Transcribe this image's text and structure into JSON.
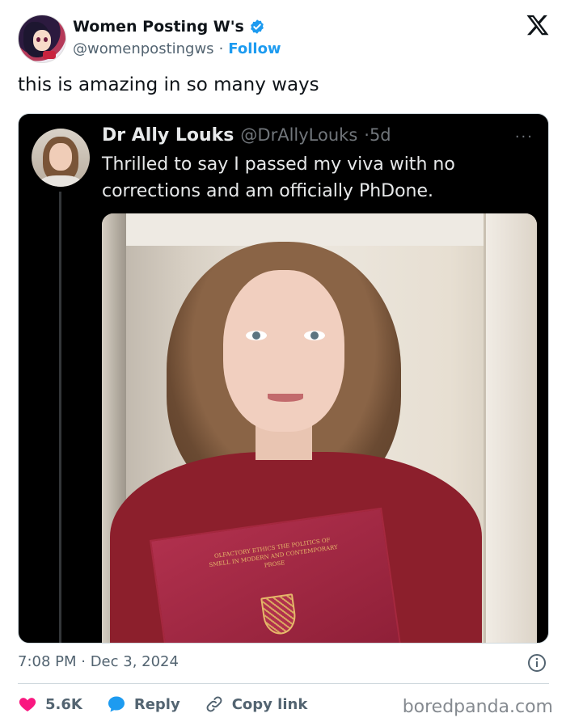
{
  "author": {
    "display_name": "Women Posting W's",
    "handle": "@womenpostingws",
    "separator": "·",
    "follow_label": "Follow"
  },
  "tweet": {
    "text": "this is amazing in so many ways",
    "timestamp": "7:08 PM · Dec 3, 2024"
  },
  "quoted_tweet": {
    "display_name": "Dr Ally Louks",
    "handle": "@DrAllyLouks",
    "age": "·5d",
    "more": "···",
    "body": "Thrilled to say I passed my viva with no corrections and am officially PhDone.",
    "book_title": "OLFACTORY ETHICS THE POLITICS OF SMELL IN MODERN AND CONTEMPORARY PROSE"
  },
  "actions": {
    "like_count": "5.6K",
    "reply_label": "Reply",
    "copy_link_label": "Copy link"
  },
  "watermark": "boredpanda.com",
  "colors": {
    "verified_blue": "#1d9bf0",
    "like_red": "#f91880",
    "reply_blue": "#1d9bf0",
    "quote_bg": "#000000",
    "secondary_text": "#536471"
  },
  "icons": {
    "verified": "verified-badge-icon",
    "platform": "x-logo-icon",
    "info": "info-icon",
    "like": "heart-icon",
    "reply": "reply-bubble-icon",
    "copy": "link-icon"
  }
}
